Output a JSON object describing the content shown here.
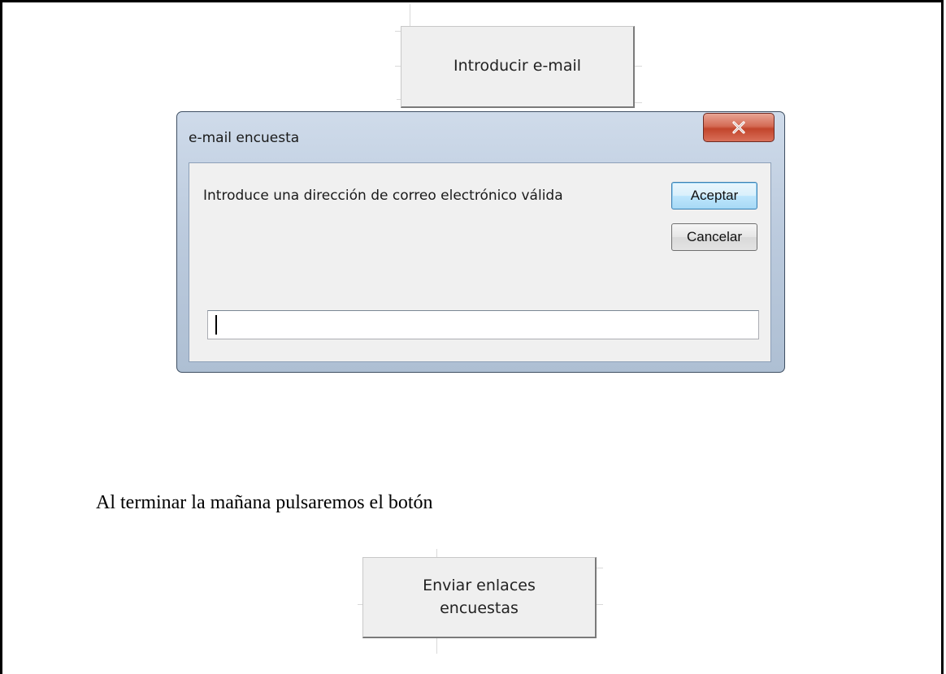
{
  "sheet": {
    "email_button_label": "Introducir e-mail",
    "body_text": "Al terminar la mañana pulsaremos el botón",
    "send_button_label": "Enviar enlaces encuestas"
  },
  "dialog": {
    "title": "e-mail encuesta",
    "close_icon": "close-x-icon",
    "prompt": "Introduce una dirección de correo electrónico válida",
    "ok_label": "Aceptar",
    "cancel_label": "Cancelar",
    "input_value": "",
    "input_placeholder": ""
  },
  "colors": {
    "dialog_frame": "#bccbde",
    "close_button": "#c2452c",
    "default_button_border": "#3c7fb1"
  }
}
